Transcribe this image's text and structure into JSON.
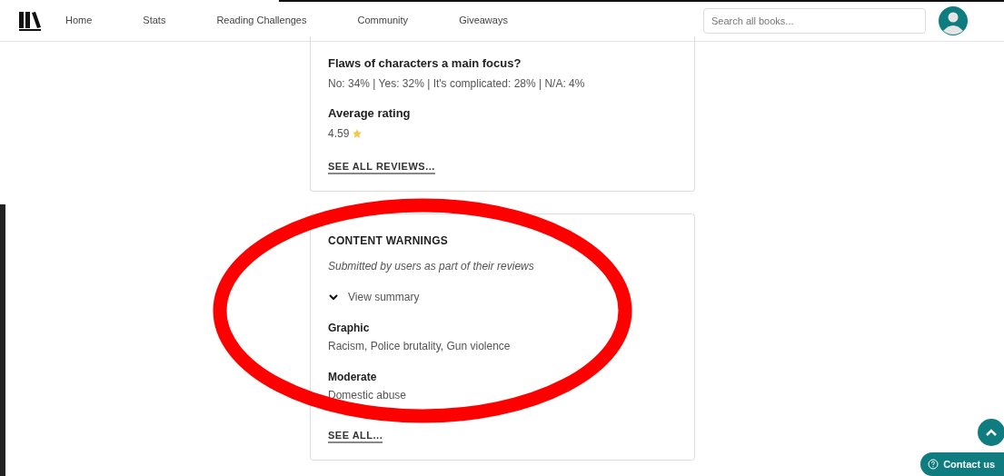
{
  "nav": {
    "links": [
      {
        "label": "Home"
      },
      {
        "label": "Stats"
      },
      {
        "label": "Reading Challenges"
      },
      {
        "label": "Community"
      },
      {
        "label": "Giveaways"
      }
    ],
    "search": {
      "placeholder": "Search all books..."
    }
  },
  "stats_card": {
    "questions": [
      {
        "title": "Flaws of characters a main focus?",
        "answer": "No: 34% | Yes: 32% | It's complicated: 28% | N/A: 4%"
      }
    ],
    "rating": {
      "title": "Average rating",
      "value": "4.59"
    },
    "link": "SEE ALL REVIEWS..."
  },
  "warnings_card": {
    "title": "CONTENT WARNINGS",
    "subtitle": "Submitted by users as part of their reviews",
    "toggle": {
      "label": "View summary",
      "expanded": false
    },
    "groups": [
      {
        "severity": "Graphic",
        "items": "Racism, Police brutality, Gun violence"
      },
      {
        "severity": "Moderate",
        "items": "Domestic abuse"
      }
    ],
    "link": "SEE ALL..."
  },
  "contact": {
    "label": "Contact us"
  }
}
